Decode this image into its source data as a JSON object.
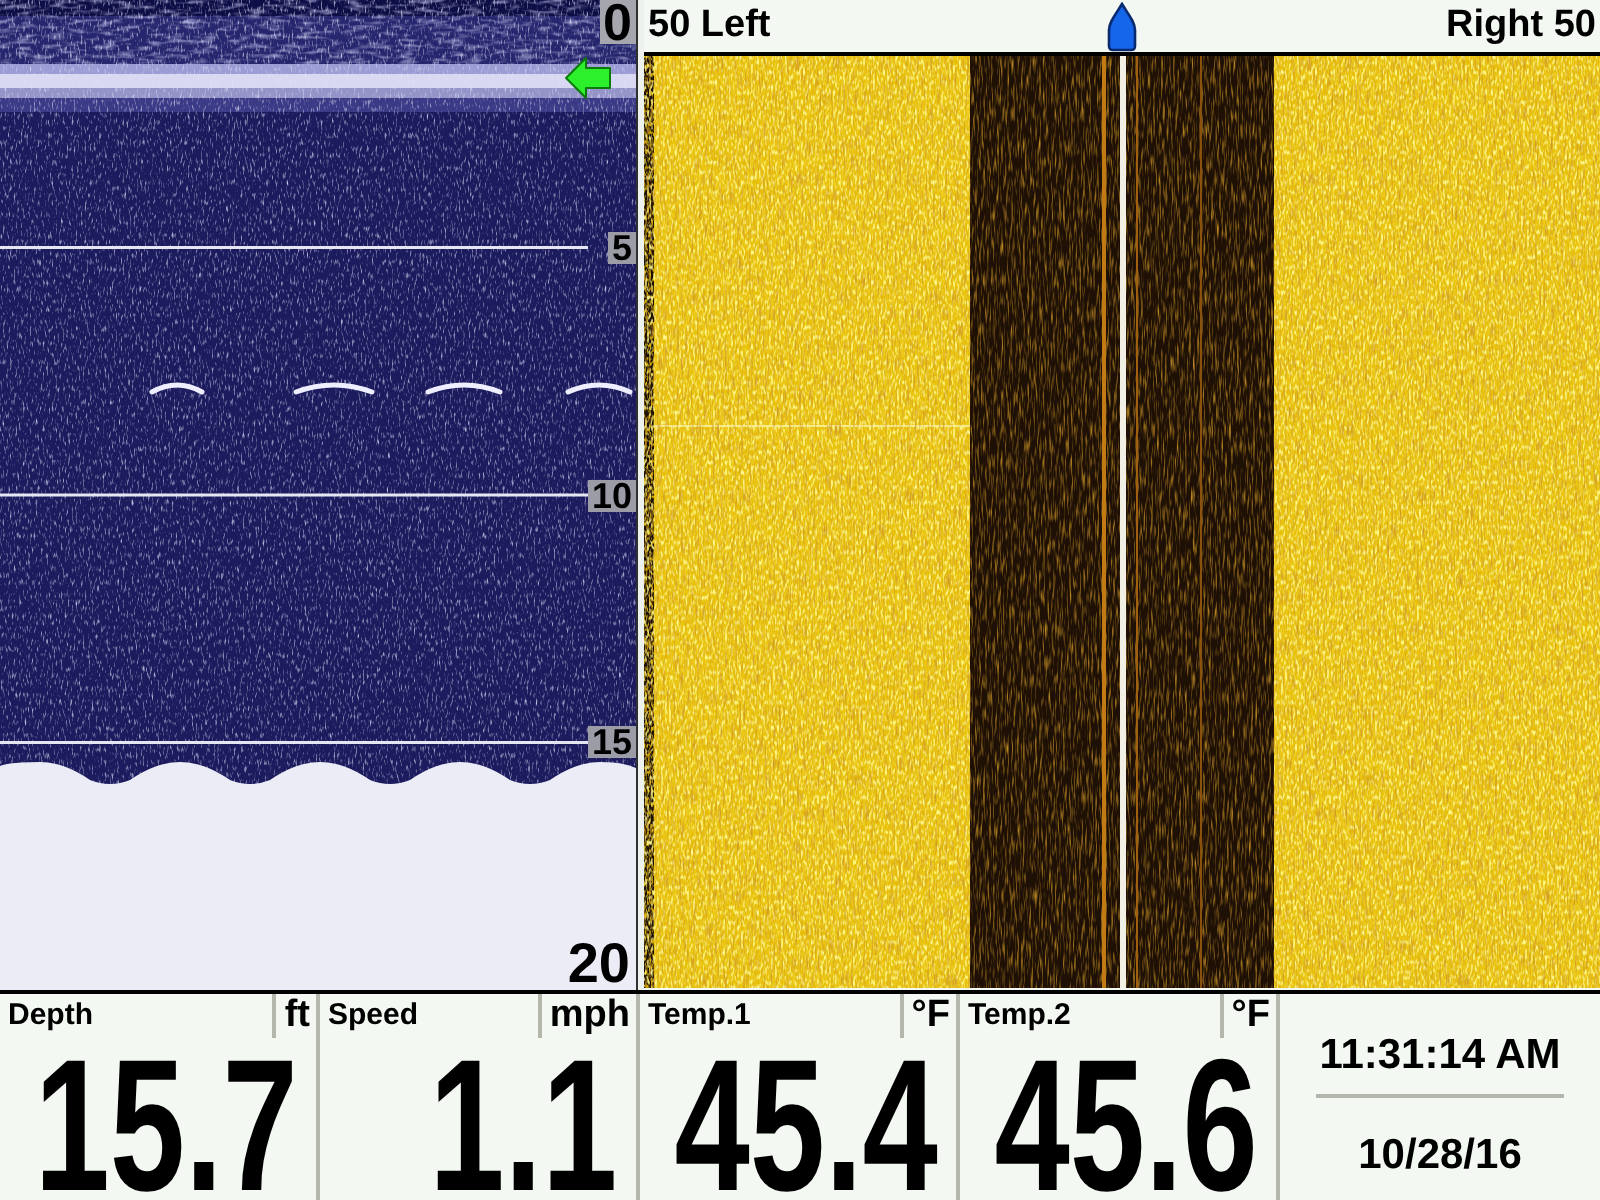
{
  "sonar_2d": {
    "depth_scale": [
      "0",
      "5",
      "10",
      "15",
      "20"
    ]
  },
  "side_imaging": {
    "left_range": "50 Left",
    "right_range": "Right 50"
  },
  "readouts": [
    {
      "label": "Depth",
      "unit": "ft",
      "value": "15.7"
    },
    {
      "label": "Speed",
      "unit": "mph",
      "value": "1.1"
    },
    {
      "label": "Temp.1",
      "unit": "°F",
      "value": "45.4"
    },
    {
      "label": "Temp.2",
      "unit": "°F",
      "value": "45.6"
    }
  ],
  "clock": {
    "time": "11:31:14 AM",
    "date": "10/28/16"
  }
}
